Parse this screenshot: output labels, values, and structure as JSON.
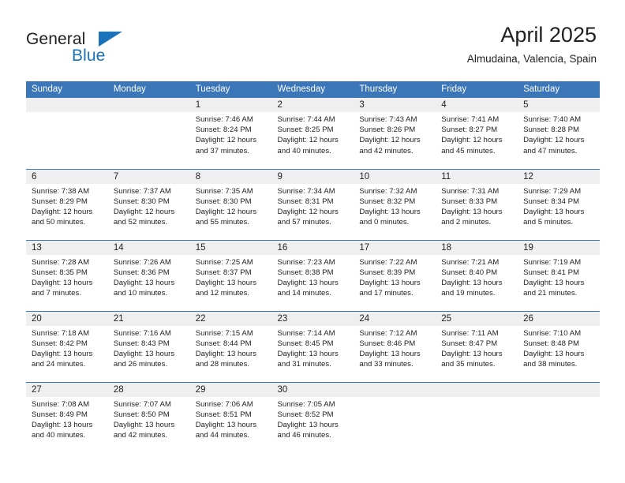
{
  "brand": {
    "name_dark": "General",
    "name_blue": "Blue",
    "triangle_icon": "blue-triangle-icon",
    "accent_color": "#1a72ba"
  },
  "header": {
    "title": "April 2025",
    "subtitle": "Almudaina, Valencia, Spain"
  },
  "theme": {
    "header_row_bg": "#3a76b8",
    "day_number_bg": "#efefef",
    "row_divider": "#3a76b8",
    "text": "#231f20"
  },
  "calendar": {
    "weekday_headers": [
      "Sunday",
      "Monday",
      "Tuesday",
      "Wednesday",
      "Thursday",
      "Friday",
      "Saturday"
    ],
    "labels": {
      "sunrise": "Sunrise:",
      "sunset": "Sunset:",
      "daylight": "Daylight:"
    },
    "weeks": [
      [
        {
          "day": "",
          "sunrise": "",
          "sunset": "",
          "daylight": "",
          "empty": true
        },
        {
          "day": "",
          "sunrise": "",
          "sunset": "",
          "daylight": "",
          "empty": true
        },
        {
          "day": "1",
          "sunrise": "Sunrise: 7:46 AM",
          "sunset": "Sunset: 8:24 PM",
          "daylight": "Daylight: 12 hours and 37 minutes."
        },
        {
          "day": "2",
          "sunrise": "Sunrise: 7:44 AM",
          "sunset": "Sunset: 8:25 PM",
          "daylight": "Daylight: 12 hours and 40 minutes."
        },
        {
          "day": "3",
          "sunrise": "Sunrise: 7:43 AM",
          "sunset": "Sunset: 8:26 PM",
          "daylight": "Daylight: 12 hours and 42 minutes."
        },
        {
          "day": "4",
          "sunrise": "Sunrise: 7:41 AM",
          "sunset": "Sunset: 8:27 PM",
          "daylight": "Daylight: 12 hours and 45 minutes."
        },
        {
          "day": "5",
          "sunrise": "Sunrise: 7:40 AM",
          "sunset": "Sunset: 8:28 PM",
          "daylight": "Daylight: 12 hours and 47 minutes."
        }
      ],
      [
        {
          "day": "6",
          "sunrise": "Sunrise: 7:38 AM",
          "sunset": "Sunset: 8:29 PM",
          "daylight": "Daylight: 12 hours and 50 minutes."
        },
        {
          "day": "7",
          "sunrise": "Sunrise: 7:37 AM",
          "sunset": "Sunset: 8:30 PM",
          "daylight": "Daylight: 12 hours and 52 minutes."
        },
        {
          "day": "8",
          "sunrise": "Sunrise: 7:35 AM",
          "sunset": "Sunset: 8:30 PM",
          "daylight": "Daylight: 12 hours and 55 minutes."
        },
        {
          "day": "9",
          "sunrise": "Sunrise: 7:34 AM",
          "sunset": "Sunset: 8:31 PM",
          "daylight": "Daylight: 12 hours and 57 minutes."
        },
        {
          "day": "10",
          "sunrise": "Sunrise: 7:32 AM",
          "sunset": "Sunset: 8:32 PM",
          "daylight": "Daylight: 13 hours and 0 minutes."
        },
        {
          "day": "11",
          "sunrise": "Sunrise: 7:31 AM",
          "sunset": "Sunset: 8:33 PM",
          "daylight": "Daylight: 13 hours and 2 minutes."
        },
        {
          "day": "12",
          "sunrise": "Sunrise: 7:29 AM",
          "sunset": "Sunset: 8:34 PM",
          "daylight": "Daylight: 13 hours and 5 minutes."
        }
      ],
      [
        {
          "day": "13",
          "sunrise": "Sunrise: 7:28 AM",
          "sunset": "Sunset: 8:35 PM",
          "daylight": "Daylight: 13 hours and 7 minutes."
        },
        {
          "day": "14",
          "sunrise": "Sunrise: 7:26 AM",
          "sunset": "Sunset: 8:36 PM",
          "daylight": "Daylight: 13 hours and 10 minutes."
        },
        {
          "day": "15",
          "sunrise": "Sunrise: 7:25 AM",
          "sunset": "Sunset: 8:37 PM",
          "daylight": "Daylight: 13 hours and 12 minutes."
        },
        {
          "day": "16",
          "sunrise": "Sunrise: 7:23 AM",
          "sunset": "Sunset: 8:38 PM",
          "daylight": "Daylight: 13 hours and 14 minutes."
        },
        {
          "day": "17",
          "sunrise": "Sunrise: 7:22 AM",
          "sunset": "Sunset: 8:39 PM",
          "daylight": "Daylight: 13 hours and 17 minutes."
        },
        {
          "day": "18",
          "sunrise": "Sunrise: 7:21 AM",
          "sunset": "Sunset: 8:40 PM",
          "daylight": "Daylight: 13 hours and 19 minutes."
        },
        {
          "day": "19",
          "sunrise": "Sunrise: 7:19 AM",
          "sunset": "Sunset: 8:41 PM",
          "daylight": "Daylight: 13 hours and 21 minutes."
        }
      ],
      [
        {
          "day": "20",
          "sunrise": "Sunrise: 7:18 AM",
          "sunset": "Sunset: 8:42 PM",
          "daylight": "Daylight: 13 hours and 24 minutes."
        },
        {
          "day": "21",
          "sunrise": "Sunrise: 7:16 AM",
          "sunset": "Sunset: 8:43 PM",
          "daylight": "Daylight: 13 hours and 26 minutes."
        },
        {
          "day": "22",
          "sunrise": "Sunrise: 7:15 AM",
          "sunset": "Sunset: 8:44 PM",
          "daylight": "Daylight: 13 hours and 28 minutes."
        },
        {
          "day": "23",
          "sunrise": "Sunrise: 7:14 AM",
          "sunset": "Sunset: 8:45 PM",
          "daylight": "Daylight: 13 hours and 31 minutes."
        },
        {
          "day": "24",
          "sunrise": "Sunrise: 7:12 AM",
          "sunset": "Sunset: 8:46 PM",
          "daylight": "Daylight: 13 hours and 33 minutes."
        },
        {
          "day": "25",
          "sunrise": "Sunrise: 7:11 AM",
          "sunset": "Sunset: 8:47 PM",
          "daylight": "Daylight: 13 hours and 35 minutes."
        },
        {
          "day": "26",
          "sunrise": "Sunrise: 7:10 AM",
          "sunset": "Sunset: 8:48 PM",
          "daylight": "Daylight: 13 hours and 38 minutes."
        }
      ],
      [
        {
          "day": "27",
          "sunrise": "Sunrise: 7:08 AM",
          "sunset": "Sunset: 8:49 PM",
          "daylight": "Daylight: 13 hours and 40 minutes."
        },
        {
          "day": "28",
          "sunrise": "Sunrise: 7:07 AM",
          "sunset": "Sunset: 8:50 PM",
          "daylight": "Daylight: 13 hours and 42 minutes."
        },
        {
          "day": "29",
          "sunrise": "Sunrise: 7:06 AM",
          "sunset": "Sunset: 8:51 PM",
          "daylight": "Daylight: 13 hours and 44 minutes."
        },
        {
          "day": "30",
          "sunrise": "Sunrise: 7:05 AM",
          "sunset": "Sunset: 8:52 PM",
          "daylight": "Daylight: 13 hours and 46 minutes."
        },
        {
          "day": "",
          "sunrise": "",
          "sunset": "",
          "daylight": "",
          "empty": true
        },
        {
          "day": "",
          "sunrise": "",
          "sunset": "",
          "daylight": "",
          "empty": true
        },
        {
          "day": "",
          "sunrise": "",
          "sunset": "",
          "daylight": "",
          "empty": true
        }
      ]
    ]
  }
}
